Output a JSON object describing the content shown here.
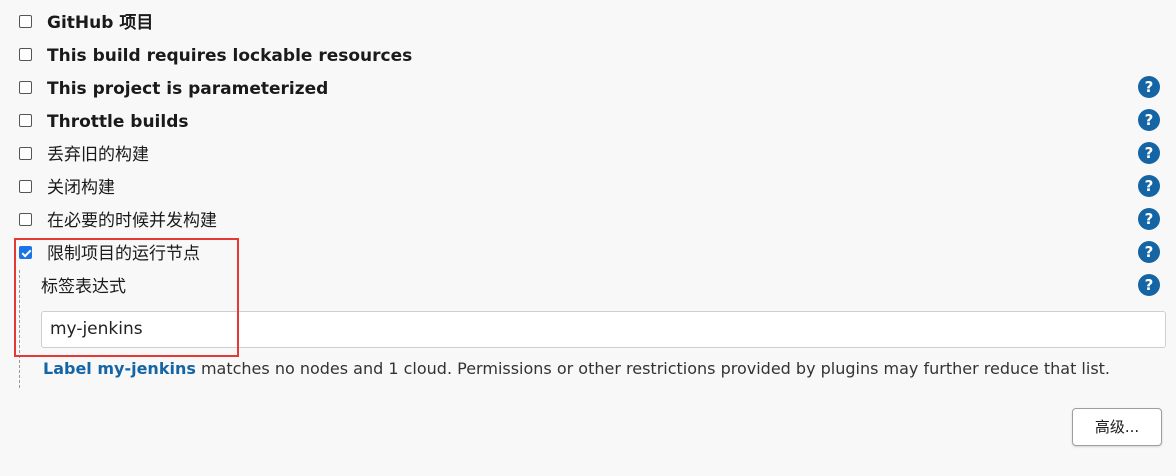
{
  "options": [
    {
      "label": "GitHub 项目",
      "checked": false,
      "help": false
    },
    {
      "label": "This build requires lockable resources",
      "checked": false,
      "help": false
    },
    {
      "label": "This project is parameterized",
      "checked": false,
      "help": true
    },
    {
      "label": "Throttle builds",
      "checked": false,
      "help": true
    },
    {
      "label": "丢弃旧的构建",
      "checked": false,
      "help": true
    },
    {
      "label": "关闭构建",
      "checked": false,
      "help": true
    },
    {
      "label": "在必要的时候并发构建",
      "checked": false,
      "help": true
    },
    {
      "label": "限制项目的运行节点",
      "checked": true,
      "help": true
    }
  ],
  "help_icon_text": "?",
  "label_expression": {
    "label": "标签表达式",
    "value": "my-jenkins"
  },
  "message": {
    "link_text": "Label my-jenkins",
    "text": " matches no nodes and 1 cloud. Permissions or other restrictions provided by plugins may further reduce that list."
  },
  "advanced_button": "高级...",
  "colors": {
    "help": "#1565a5",
    "highlight": "#e53935",
    "checkbox_checked": "#1a73e8"
  }
}
